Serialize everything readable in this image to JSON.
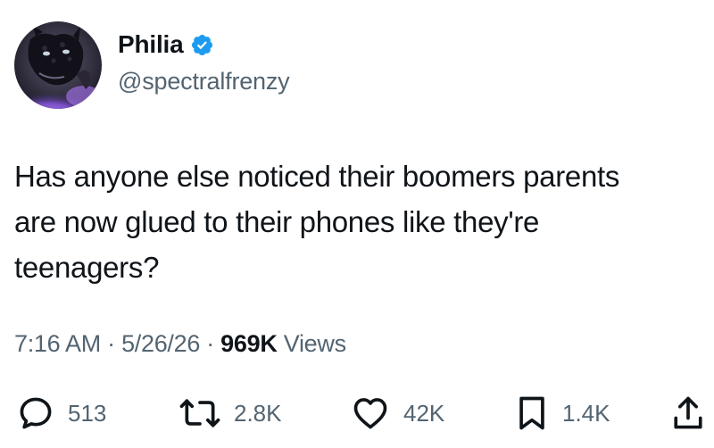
{
  "author": {
    "display_name": "Philia",
    "handle": "@spectralfrenzy",
    "verified": true,
    "avatar_icon": "panther-avatar",
    "verified_color": "#1d9bf0"
  },
  "tweet": {
    "text": "Has anyone else noticed their boomers parents\nare now glued to their phones like they're\nteenagers?"
  },
  "meta": {
    "time": "7:16 AM",
    "separator": " · ",
    "date": "5/26/26",
    "views_count": "969K",
    "views_label": " Views"
  },
  "actions": {
    "replies": {
      "icon": "reply-icon",
      "count": "513"
    },
    "retweets": {
      "icon": "retweet-icon",
      "count": "2.8K"
    },
    "likes": {
      "icon": "heart-icon",
      "count": "42K"
    },
    "bookmarks": {
      "icon": "bookmark-icon",
      "count": "1.4K"
    },
    "share": {
      "icon": "share-icon"
    }
  },
  "colors": {
    "text_primary": "#0f1419",
    "text_secondary": "#536471",
    "accent": "#1d9bf0"
  }
}
